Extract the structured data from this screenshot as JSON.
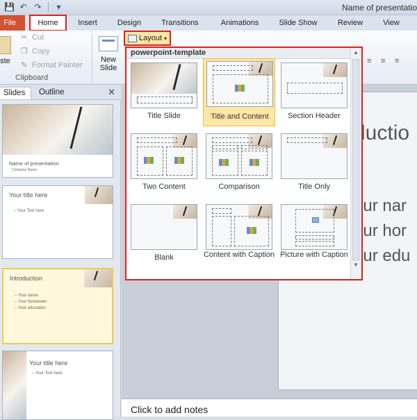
{
  "window_title": "Name of presentatio",
  "tabs": [
    "File",
    "Home",
    "Insert",
    "Design",
    "Transitions",
    "Animations",
    "Slide Show",
    "Review",
    "View"
  ],
  "clipboard": {
    "paste": "aste",
    "cut": "Cut",
    "copy": "Copy",
    "format_painter": "Format Painter",
    "group": "Clipboard"
  },
  "new_slide": "New Slide",
  "layout_button": "Layout",
  "font_size": "32",
  "gallery": {
    "header": "powerpoint-template",
    "items": [
      "Title Slide",
      "Title and Content",
      "Section Header",
      "Two Content",
      "Comparison",
      "Title Only",
      "Blank",
      "Content with Caption",
      "Picture with Caption"
    ],
    "selected": "Title and Content"
  },
  "pane": {
    "tab_slides": "Slides",
    "tab_outline": "Outline"
  },
  "thumbnails": [
    {
      "title": "Name of presentation",
      "subtitle": "Company Name"
    },
    {
      "title": "Your title here",
      "bullets": "– Your Text here"
    },
    {
      "title": "Introduction",
      "bullets": "– Your name\n– Your hometown\n– Your education"
    },
    {
      "title": "Your title here",
      "bullets": "– Your Text here"
    }
  ],
  "slide": {
    "heading": "ductio",
    "lines": [
      "our nar",
      "our hor",
      "our edu"
    ]
  },
  "notes_placeholder": "Click to add notes"
}
